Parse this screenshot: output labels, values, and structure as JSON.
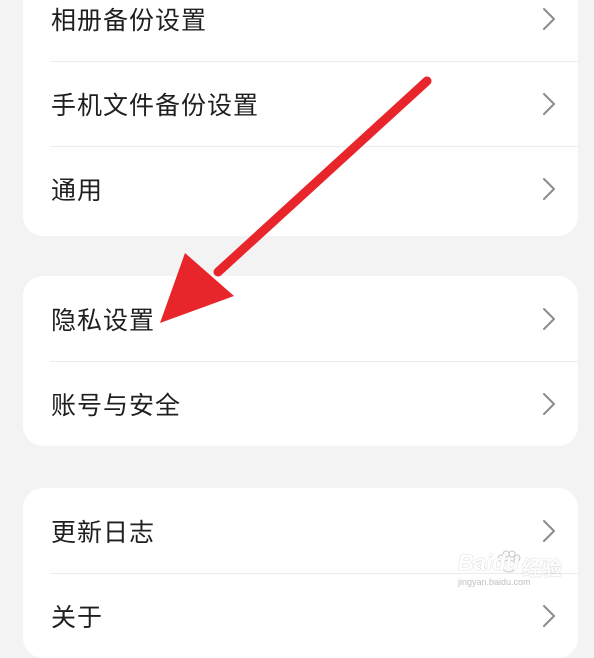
{
  "groups": [
    {
      "items": [
        {
          "label": "相册备份设置"
        },
        {
          "label": "手机文件备份设置"
        },
        {
          "label": "通用"
        }
      ]
    },
    {
      "items": [
        {
          "label": "隐私设置"
        },
        {
          "label": "账号与安全"
        }
      ]
    },
    {
      "items": [
        {
          "label": "更新日志"
        },
        {
          "label": "关于"
        }
      ]
    }
  ],
  "annotation": {
    "color": "#e8252b",
    "icon": "red-arrow-icon"
  },
  "watermark": {
    "brand": "Baidu",
    "suffix": "经验",
    "url": "jingyan.baidu.com"
  }
}
